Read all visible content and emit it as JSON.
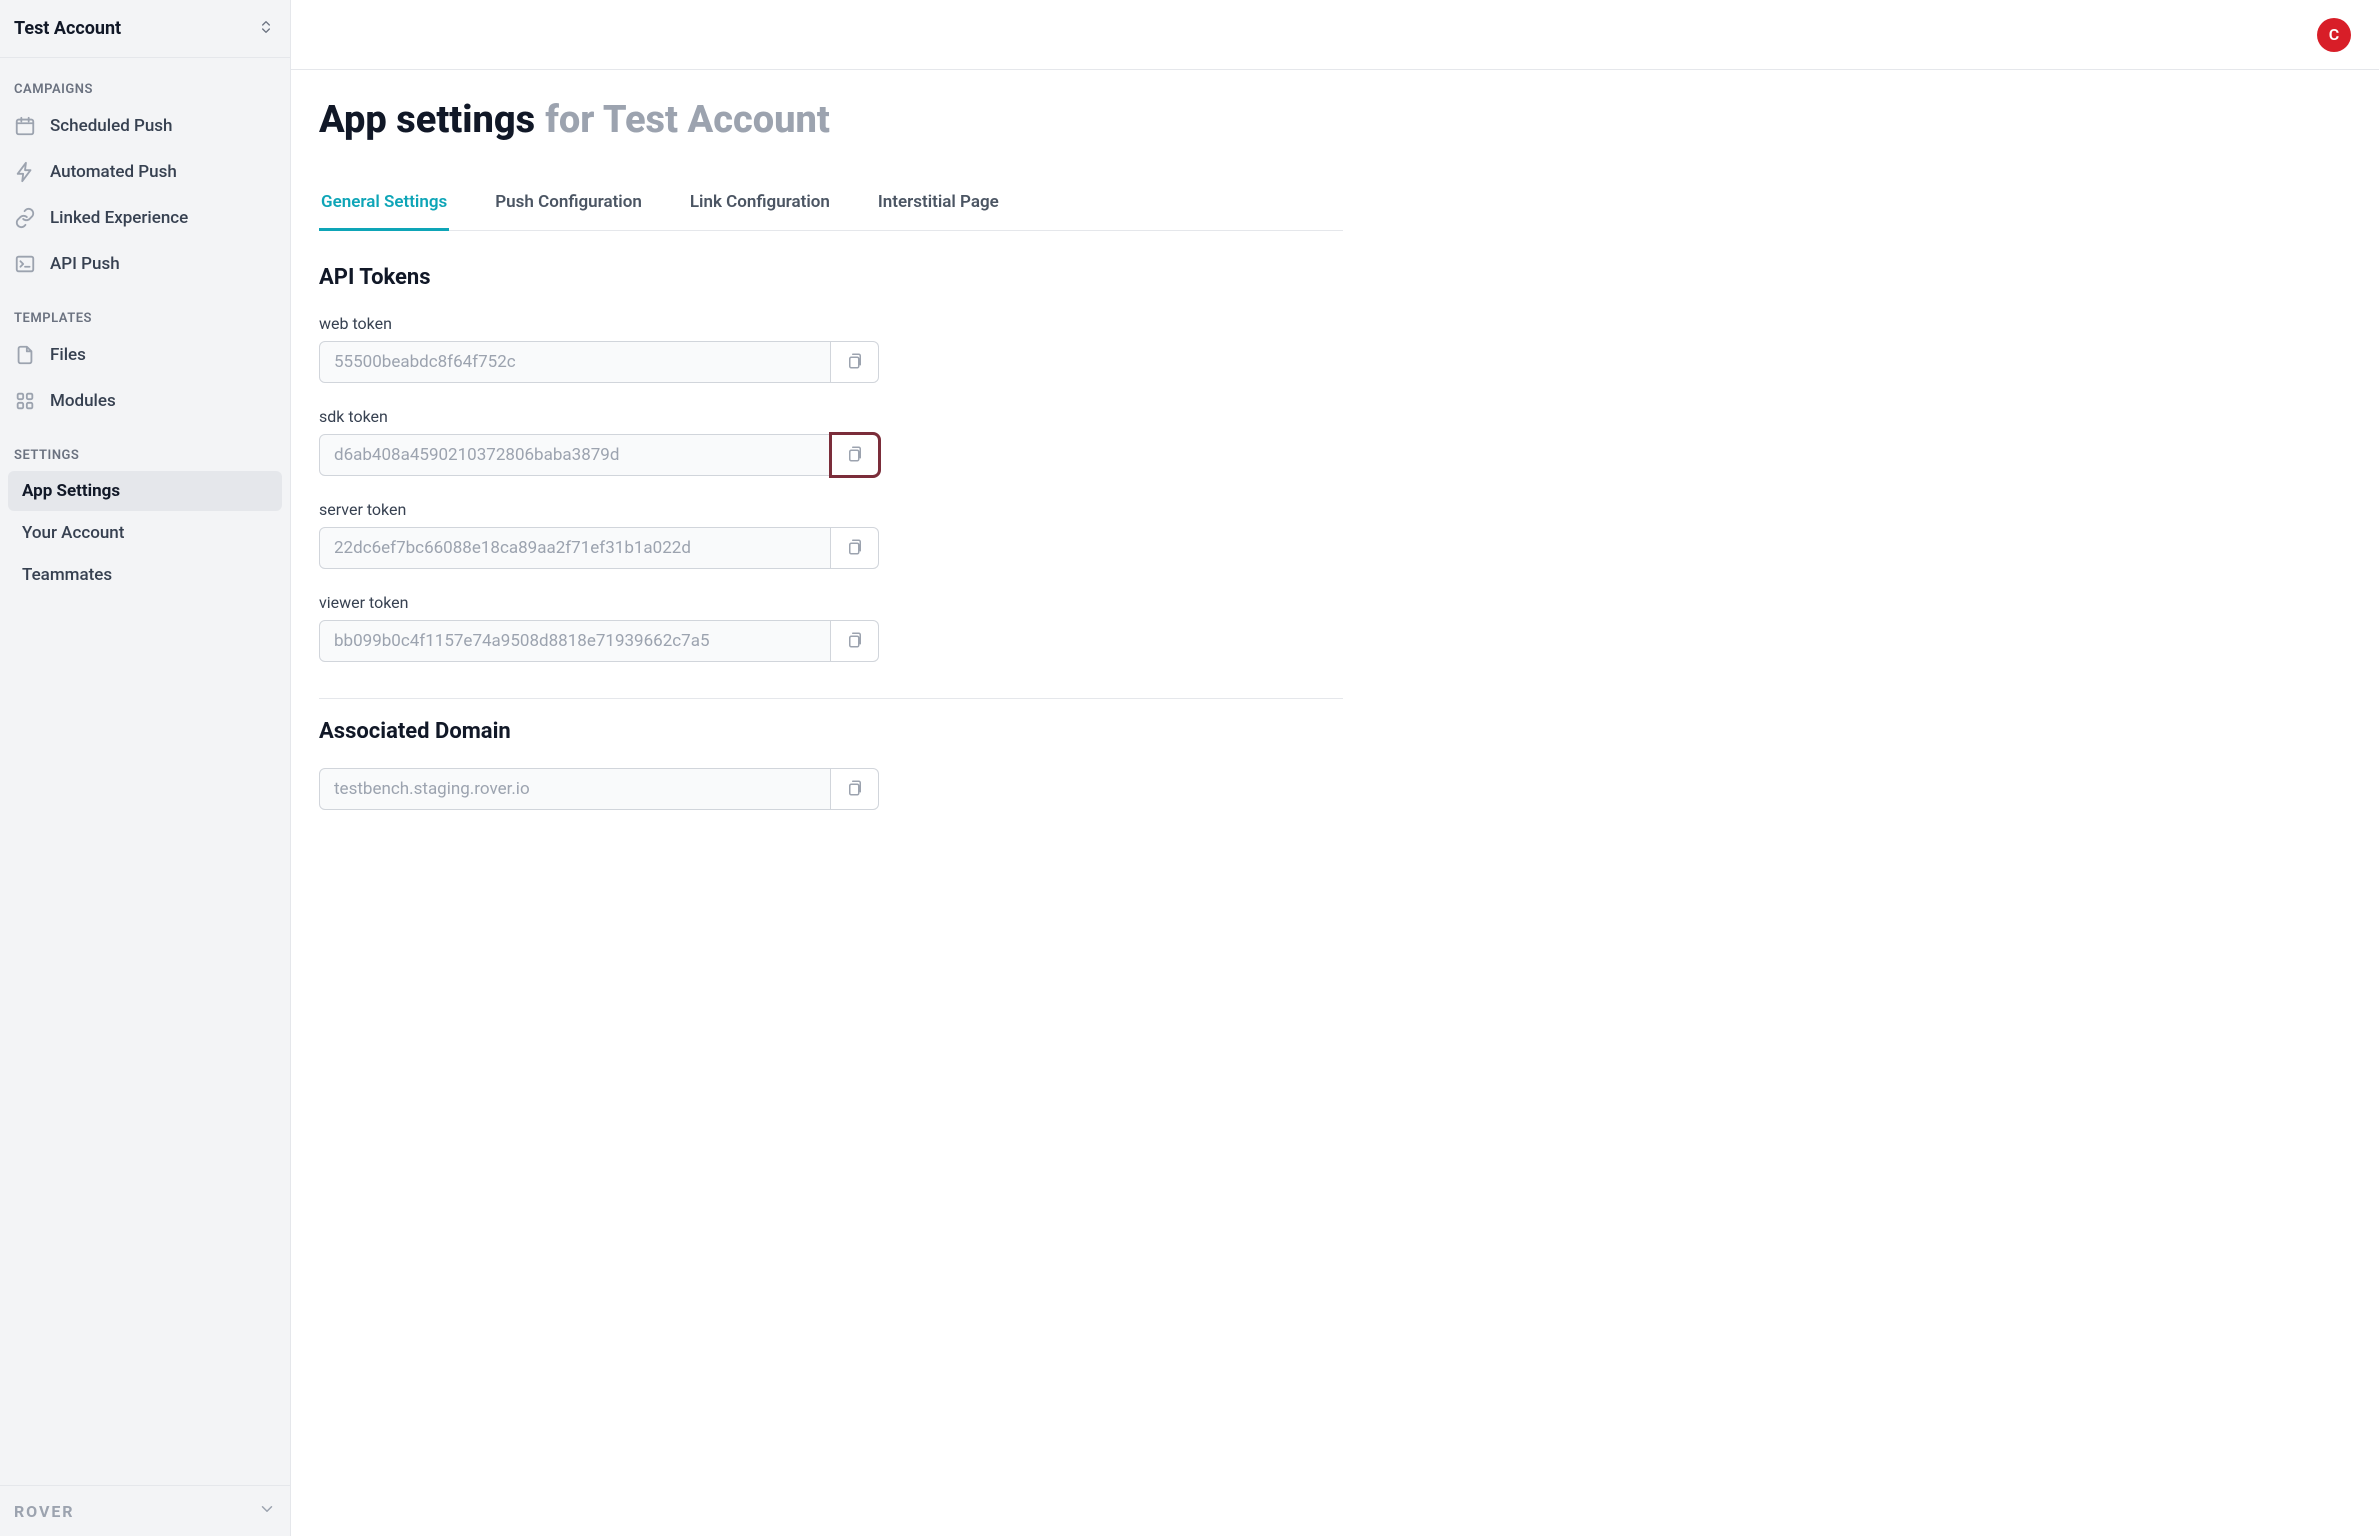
{
  "account_name": "Test Account",
  "avatar_letter": "C",
  "brand": "ROVER",
  "page_title_main": "App settings",
  "page_title_sub": "for Test Account",
  "sidebar": {
    "sections": {
      "campaigns_label": "CAMPAIGNS",
      "templates_label": "TEMPLATES",
      "settings_label": "SETTINGS"
    },
    "campaigns": [
      {
        "label": "Scheduled Push",
        "icon": "calendar-icon"
      },
      {
        "label": "Automated Push",
        "icon": "lightning-icon"
      },
      {
        "label": "Linked Experience",
        "icon": "link-icon"
      },
      {
        "label": "API Push",
        "icon": "terminal-icon"
      }
    ],
    "templates": [
      {
        "label": "Files",
        "icon": "file-icon"
      },
      {
        "label": "Modules",
        "icon": "grid-icon"
      }
    ],
    "settings": [
      {
        "label": "App Settings",
        "active": true
      },
      {
        "label": "Your Account",
        "active": false
      },
      {
        "label": "Teammates",
        "active": false
      }
    ]
  },
  "tabs": [
    {
      "label": "General Settings",
      "active": true
    },
    {
      "label": "Push Configuration",
      "active": false
    },
    {
      "label": "Link Configuration",
      "active": false
    },
    {
      "label": "Interstitial Page",
      "active": false
    }
  ],
  "api_tokens_heading": "API Tokens",
  "tokens": [
    {
      "label": "web token",
      "value": "55500beabdc8f64f752c",
      "highlight": false
    },
    {
      "label": "sdk token",
      "value": "d6ab408a4590210372806baba3879d",
      "highlight": true
    },
    {
      "label": "server token",
      "value": "22dc6ef7bc66088e18ca89aa2f71ef31b1a022d",
      "highlight": false
    },
    {
      "label": "viewer token",
      "value": "bb099b0c4f1157e74a9508d8818e71939662c7a5",
      "highlight": false
    }
  ],
  "associated_domain_heading": "Associated Domain",
  "associated_domain_value": "testbench.staging.rover.io"
}
